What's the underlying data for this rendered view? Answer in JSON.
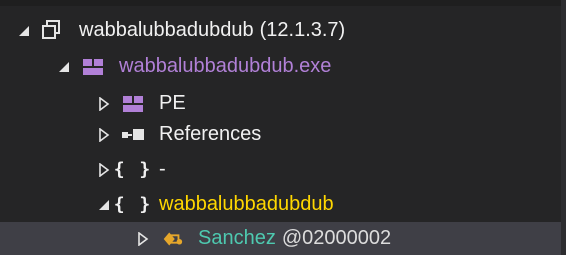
{
  "tree": {
    "root": {
      "name": "wabbalubbadubdub",
      "version": "(12.1.3.7)",
      "icon": "assembly-icon"
    },
    "module": {
      "label": "wabbalubbadubdub.exe",
      "icon": "module-icon"
    },
    "children": [
      {
        "label": "PE",
        "icon": "pe-icon"
      },
      {
        "label": "References",
        "icon": "references-icon"
      },
      {
        "label": "-",
        "icon": "namespace-icon"
      },
      {
        "label": "wabbalubbadubdub",
        "icon": "namespace-icon"
      }
    ],
    "selected": {
      "label": "Sanchez",
      "token": "@02000002",
      "icon": "class-icon"
    }
  },
  "colors": {
    "background": "#252526",
    "selection": "#3f3f46",
    "text": "#f1f1f1",
    "module_text": "#b180d7",
    "namespace_text": "#ffd700",
    "type_text": "#4ec9b0"
  }
}
